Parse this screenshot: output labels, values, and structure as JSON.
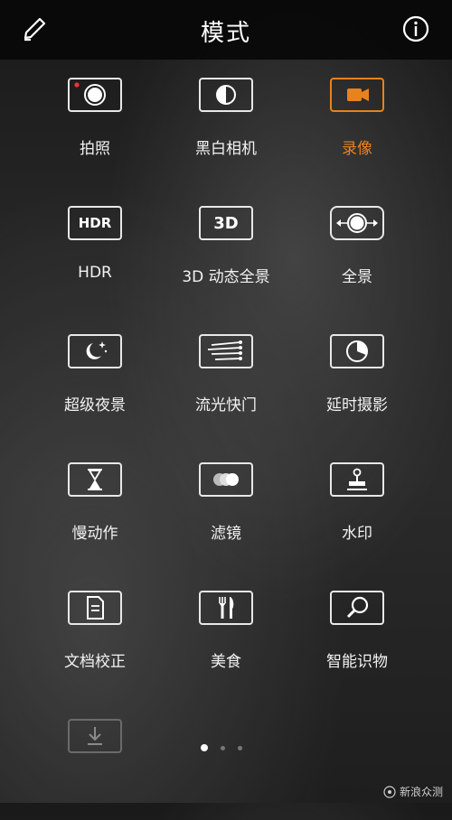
{
  "header": {
    "title": "模式",
    "left_icon": "edit-icon",
    "right_icon": "info-icon"
  },
  "modes": [
    {
      "label": "拍照",
      "icon": "photo-icon"
    },
    {
      "label": "黑白相机",
      "icon": "monochrome-icon"
    },
    {
      "label": "录像",
      "icon": "video-camera-icon",
      "active": true
    },
    {
      "label": "HDR",
      "icon": "hdr-icon",
      "icon_text": "HDR"
    },
    {
      "label": "3D 动态全景",
      "icon": "3d-panorama-icon",
      "icon_text": "3D"
    },
    {
      "label": "全景",
      "icon": "panorama-icon"
    },
    {
      "label": "超级夜景",
      "icon": "night-icon"
    },
    {
      "label": "流光快门",
      "icon": "light-painting-icon"
    },
    {
      "label": "延时摄影",
      "icon": "time-lapse-icon"
    },
    {
      "label": "慢动作",
      "icon": "hourglass-icon"
    },
    {
      "label": "滤镜",
      "icon": "filter-icon"
    },
    {
      "label": "水印",
      "icon": "stamp-icon"
    },
    {
      "label": "文档校正",
      "icon": "document-icon"
    },
    {
      "label": "美食",
      "icon": "fork-knife-icon"
    },
    {
      "label": "智能识物",
      "icon": "magnifier-icon"
    },
    {
      "label": "",
      "icon": "download-icon"
    }
  ],
  "pagination": {
    "current": 1,
    "total": 3
  },
  "watermark": {
    "text": "新浪众测"
  },
  "colors": {
    "accent": "#e8821e",
    "icon": "#e8e8e8",
    "topbar": "#080808"
  }
}
